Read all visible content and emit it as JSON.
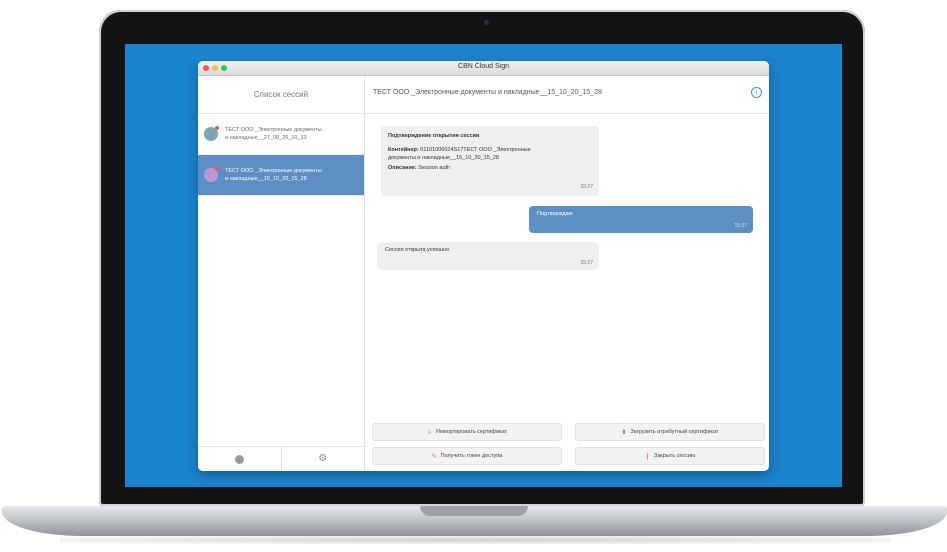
{
  "window": {
    "title": "CBN Cloud Sign"
  },
  "sidebar": {
    "header": "Список сессий",
    "items": [
      {
        "line1": "ТЕСТ ООО _Электронные документы",
        "line2": "и накладные__27_08_20_10_13"
      },
      {
        "line1": "ТЕСТ ООО _Электронные документы",
        "line2": "и накладные__15_10_20_15_28"
      }
    ],
    "footer_icons": [
      "circle-icon",
      "gear-icon"
    ]
  },
  "chat": {
    "title": "ТЕСТ ООО _Электронные документы и накладные__15_10_20_15_28",
    "messages": [
      {
        "direction": "in",
        "heading": "Подтверждение открытия сессии",
        "container_label": "Контейнер:",
        "container_value": "01101000024S17ТЕСТ ООО _Электронные",
        "container_value2": "документы и накладные__15_10_20_15_28",
        "description_label": "Описание:",
        "description_value": "Session auth",
        "time": "15:27"
      },
      {
        "direction": "out",
        "text": "Подтверждаю",
        "time": "15:27"
      },
      {
        "direction": "in",
        "text": "Сессия открыта успешно",
        "time": "15:27"
      }
    ],
    "actions": [
      {
        "label": "Импортировать сертификат",
        "icon": "import-icon"
      },
      {
        "label": "Загрузить атрибутный сертификат",
        "icon": "upload-icon"
      },
      {
        "label": "Получить токен доступа",
        "icon": "key-icon"
      },
      {
        "label": "Закрыть сессию",
        "icon": "close-session-icon"
      }
    ]
  },
  "colors": {
    "desktop": "#1b84cf",
    "accent": "#5e8fc4",
    "traffic_close": "#fc5753",
    "traffic_min": "#fdbc40",
    "traffic_max": "#33c748"
  }
}
